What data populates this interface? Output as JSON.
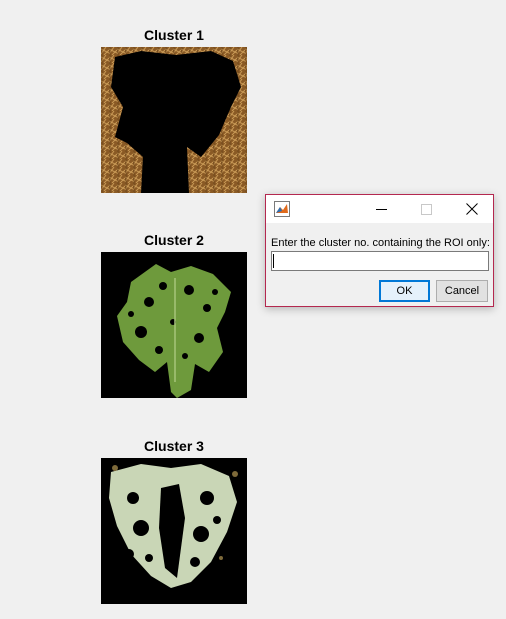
{
  "clusters": [
    {
      "title": "Cluster 1"
    },
    {
      "title": "Cluster 2"
    },
    {
      "title": "Cluster 3"
    }
  ],
  "dialog": {
    "app_icon": "matlab-icon",
    "prompt": "Enter the cluster no. containing the ROI only:",
    "input_value": "",
    "ok_label": "OK",
    "cancel_label": "Cancel",
    "border_color": "#b4284f"
  },
  "colors": {
    "background": "#f0f0f0",
    "ok_focus": "#0078d7"
  }
}
